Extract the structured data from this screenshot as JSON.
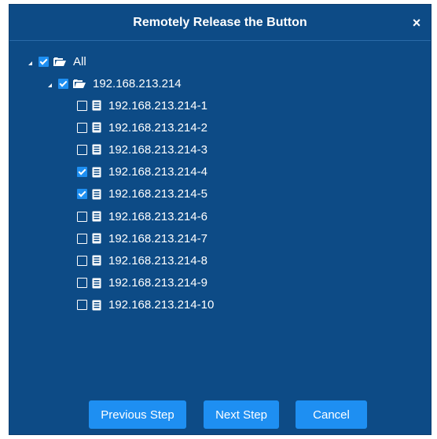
{
  "dialog": {
    "title": "Remotely Release the Button",
    "close_glyph": "×"
  },
  "tree": {
    "root": {
      "label": "All",
      "checked": true,
      "expanded": true,
      "icon": "folder-open-icon"
    },
    "group": {
      "label": "192.168.213.214",
      "checked": true,
      "expanded": true,
      "icon": "folder-open-icon"
    },
    "devices": [
      {
        "label": "192.168.213.214-1",
        "checked": false,
        "icon": "device-icon"
      },
      {
        "label": "192.168.213.214-2",
        "checked": false,
        "icon": "device-icon"
      },
      {
        "label": "192.168.213.214-3",
        "checked": false,
        "icon": "device-icon"
      },
      {
        "label": "192.168.213.214-4",
        "checked": true,
        "icon": "device-icon"
      },
      {
        "label": "192.168.213.214-5",
        "checked": true,
        "icon": "device-icon"
      },
      {
        "label": "192.168.213.214-6",
        "checked": false,
        "icon": "device-icon"
      },
      {
        "label": "192.168.213.214-7",
        "checked": false,
        "icon": "device-icon"
      },
      {
        "label": "192.168.213.214-8",
        "checked": false,
        "icon": "device-icon"
      },
      {
        "label": "192.168.213.214-9",
        "checked": false,
        "icon": "device-icon"
      },
      {
        "label": "192.168.213.214-10",
        "checked": false,
        "icon": "device-icon"
      }
    ]
  },
  "buttons": {
    "previous": "Previous Step",
    "next": "Next Step",
    "cancel": "Cancel"
  },
  "colors": {
    "panel": "#0d4b86",
    "accent": "#1e8ff2",
    "text": "#ffffff"
  }
}
